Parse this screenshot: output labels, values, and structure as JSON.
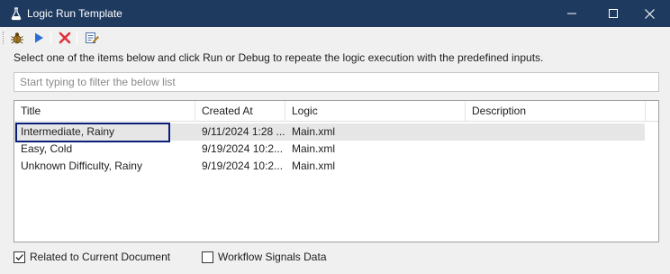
{
  "window": {
    "title": "Logic Run Template",
    "icon": "flask-icon",
    "controls": [
      "minimize-icon",
      "maximize-icon",
      "close-icon"
    ]
  },
  "toolbar": {
    "buttons": [
      {
        "icon": "bug-icon",
        "tooltip": "Debug"
      },
      {
        "icon": "play-icon",
        "tooltip": "Run"
      },
      {
        "icon": "delete-icon",
        "tooltip": "Delete"
      },
      {
        "icon": "edit-icon",
        "tooltip": "Edit"
      }
    ]
  },
  "instruction": "Select one of the items below and click Run or Debug to repeate the logic execution with the predefined inputs.",
  "filter": {
    "placeholder": "Start typing to filter the below list",
    "value": ""
  },
  "list": {
    "columns": [
      "Title",
      "Created At",
      "Logic",
      "Description"
    ],
    "rows": [
      {
        "title": "Intermediate, Rainy",
        "created_at": "9/11/2024 1:28 ...",
        "logic": "Main.xml",
        "description": "",
        "selected": true
      },
      {
        "title": "Easy, Cold",
        "created_at": "9/19/2024 10:2...",
        "logic": "Main.xml",
        "description": "",
        "selected": false
      },
      {
        "title": "Unknown Difficulty, Rainy",
        "created_at": "9/19/2024 10:2...",
        "logic": "Main.xml",
        "description": "",
        "selected": false
      }
    ]
  },
  "options": {
    "related_to_current_document": {
      "label": "Related to Current Document",
      "checked": true
    },
    "workflow_signals_data": {
      "label": "Workflow Signals Data",
      "checked": false
    }
  },
  "colors": {
    "titlebar": "#1f3a5f",
    "selection_row": "#e6e6e6",
    "focus_border": "#0b1f7a",
    "run_icon": "#2a6fd6",
    "delete_icon": "#e0303a"
  }
}
